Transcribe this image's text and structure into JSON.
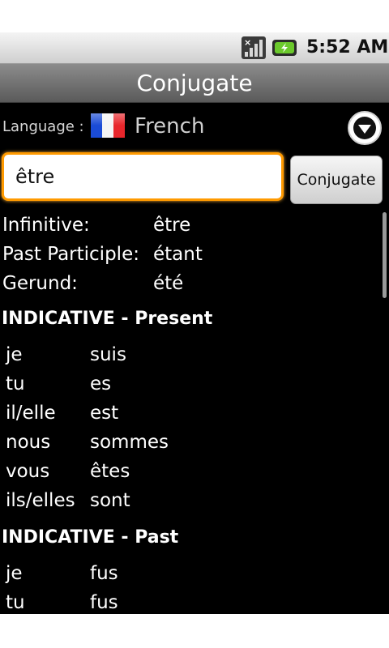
{
  "status_bar": {
    "time": "5:52 AM",
    "icons": [
      "signal-icon",
      "battery-charging-icon"
    ]
  },
  "title_bar": {
    "title": "Conjugate"
  },
  "language": {
    "label": "Language :",
    "value": "French",
    "flag_icon": "french-flag-icon",
    "dropdown_icon": "chevron-down-circle-icon"
  },
  "search": {
    "value": "être",
    "button_label": "Conjugate"
  },
  "verb_forms": [
    {
      "label": "Infinitive:",
      "value": "être"
    },
    {
      "label": "Past Participle:",
      "value": "étant"
    },
    {
      "label": "Gerund:",
      "value": "été"
    }
  ],
  "sections": [
    {
      "heading": "INDICATIVE - Present",
      "rows": [
        {
          "pronoun": "je",
          "form": "suis"
        },
        {
          "pronoun": "tu",
          "form": "es"
        },
        {
          "pronoun": "il/elle",
          "form": "est"
        },
        {
          "pronoun": "nous",
          "form": "sommes"
        },
        {
          "pronoun": "vous",
          "form": "êtes"
        },
        {
          "pronoun": "ils/elles",
          "form": "sont"
        }
      ]
    },
    {
      "heading": "INDICATIVE - Past",
      "rows": [
        {
          "pronoun": "je",
          "form": "fus"
        },
        {
          "pronoun": "tu",
          "form": "fus"
        }
      ]
    }
  ],
  "colors": {
    "input_focus": "#ff9a00",
    "background": "#000000",
    "text": "#ffffff"
  }
}
